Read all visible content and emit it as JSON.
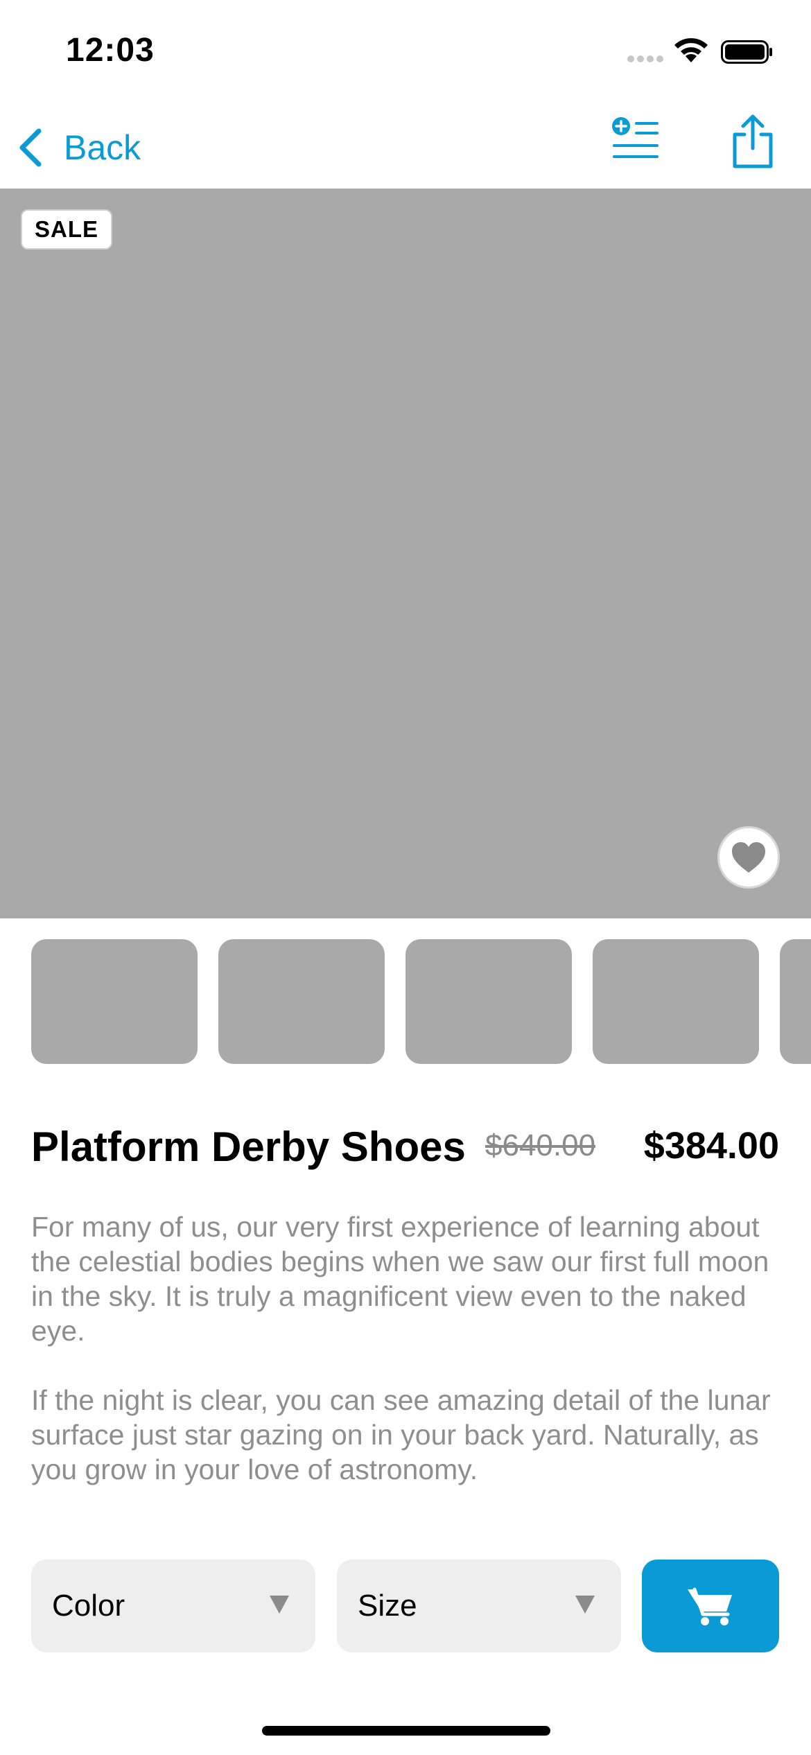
{
  "status_bar": {
    "time": "12:03"
  },
  "nav": {
    "back_label": "Back",
    "add_to_list_icon": "add-to-list-icon",
    "share_icon": "share-icon"
  },
  "hero": {
    "badge": "SALE",
    "favorite_icon": "heart-icon"
  },
  "thumbnails": {
    "count_visible": 5
  },
  "product": {
    "title": "Platform Derby Shoes",
    "original_price": "$640.00",
    "sale_price": "$384.00",
    "description": [
      "For many of us, our very first experience of learning about the celestial bodies begins when we saw our first full moon in the sky. It is truly a magnificent view even to the naked eye.",
      "If the night is clear, you can see amazing detail of the lunar surface just star gazing on in your back yard. Naturally, as you grow in your love of astronomy."
    ]
  },
  "controls": {
    "color_select": "Color",
    "size_select": "Size",
    "cart_icon": "cart-icon"
  },
  "colors": {
    "accent": "#0a9bd6",
    "placeholder": "#a9a9a9",
    "muted_text": "#8e8e8e",
    "select_bg": "#eeeeee"
  }
}
